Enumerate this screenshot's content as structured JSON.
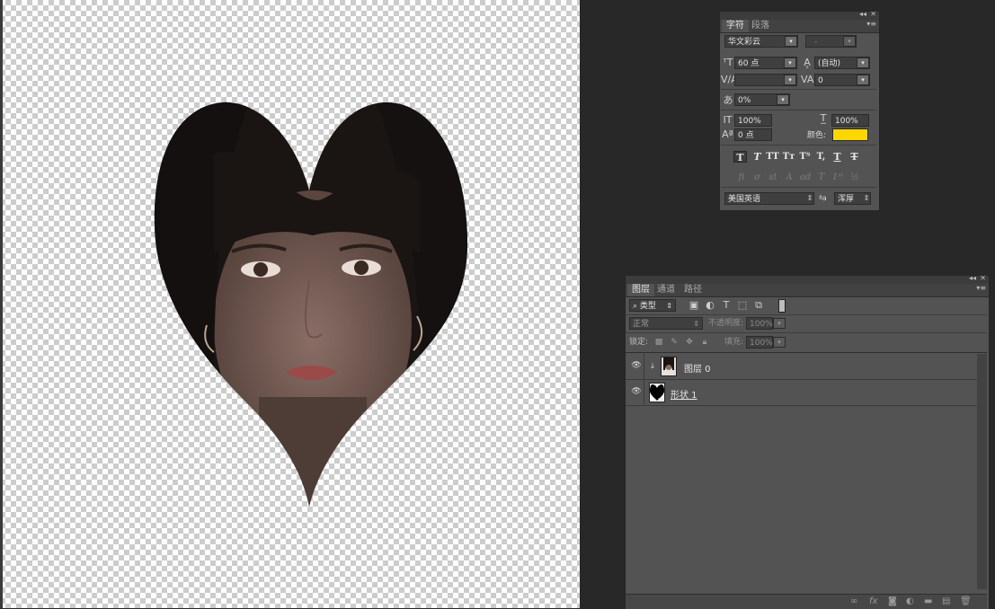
{
  "character_panel": {
    "tabs": [
      "字符",
      "段落"
    ],
    "font_family": "华文彩云",
    "font_style": "-",
    "font_size": "60 点",
    "leading": "(自动)",
    "kerning": "",
    "tracking": "0",
    "tsume": "0%",
    "vertical_scale": "100%",
    "horizontal_scale": "100%",
    "baseline_shift": "0 点",
    "color_label": "颜色:",
    "color_swatch": "#ffd700",
    "language": "美国英语",
    "aa_label": "ªa",
    "antialias": "浑厚"
  },
  "layers_panel": {
    "tabs": [
      "图层",
      "通道",
      "路径"
    ],
    "filter_kind": "类型",
    "blend_mode": "正常",
    "opacity_label": "不透明度:",
    "opacity": "100%",
    "lock_label": "锁定:",
    "fill_label": "填充:",
    "fill": "100%",
    "layers": [
      {
        "name": "图层 0",
        "type": "image",
        "clipped": true
      },
      {
        "name": "形状 1",
        "type": "shape",
        "clipped": false
      }
    ]
  },
  "icons": {
    "eye": "visibility-eye-icon",
    "link": "link-layers-icon",
    "fx": "fx-icon",
    "mask": "add-mask-icon",
    "adjust": "adjustment-layer-icon",
    "folder": "new-group-icon",
    "newlayer": "new-layer-icon",
    "trash": "delete-layer-icon"
  }
}
